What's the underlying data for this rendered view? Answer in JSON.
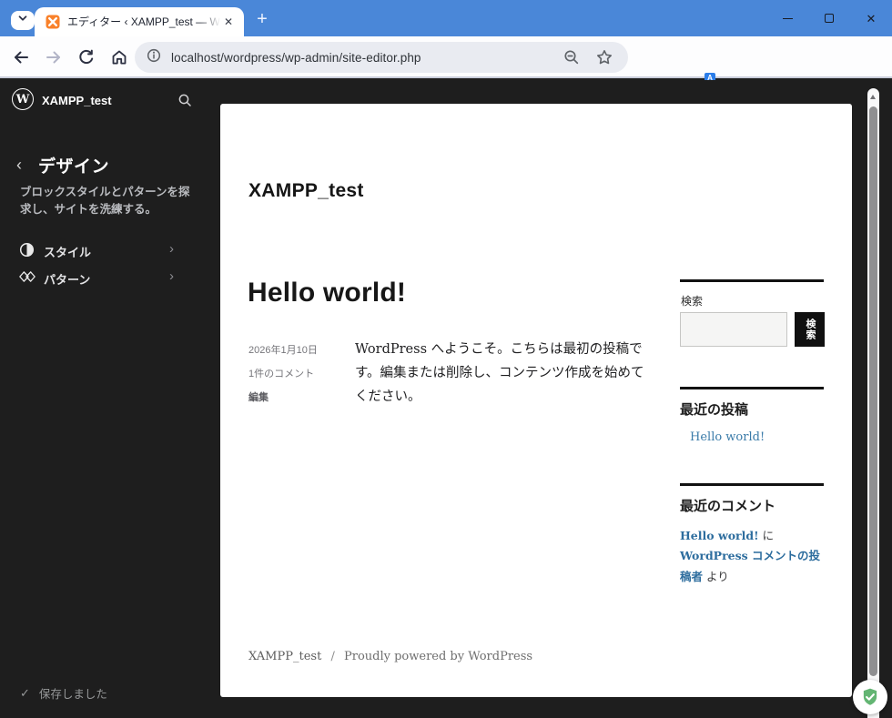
{
  "colors": {
    "tab_bar": "#4a87d8",
    "editor_bg": "#1e1e1e",
    "link_blue": "#3a7ba9",
    "comment_link_blue": "#2d6d9e",
    "search_button_bg": "#101010",
    "adguard_green": "#5cb273"
  },
  "icons": {
    "new_tab": "+",
    "close_tab": "✕",
    "kebab": "⋮",
    "back_chevron": "‹",
    "menu_chevron": "›",
    "saved_check": "✓",
    "wp_logo_letter": "W",
    "translate_back": "文",
    "translate_front": "A",
    "darkbadge_glyph": "</>"
  },
  "browser": {
    "tab_title": "エディター ‹ XAMPP_test — WordP",
    "url": "localhost/wordpress/wp-admin/site-editor.php"
  },
  "sidebar": {
    "site_name": "XAMPP_test",
    "nav_title": "デザイン",
    "description": "ブロックスタイルとパターンを探求し、サイトを洗練する。",
    "items": [
      {
        "label": "スタイル"
      },
      {
        "label": "パターン"
      }
    ],
    "save_status": "保存しました"
  },
  "page": {
    "site_title": "XAMPP_test",
    "post": {
      "title": "Hello world!",
      "date": "2026年1月10日",
      "comments": "1件のコメント",
      "edit": "編集",
      "content": "WordPress へようこそ。こちらは最初の投稿です。編集または削除し、コンテンツ作成を始めてください。"
    },
    "widgets": {
      "search": {
        "label": "検索",
        "button": "検索",
        "input_value": "",
        "input_placeholder": ""
      },
      "recent_posts": {
        "heading": "最近の投稿",
        "items": [
          "Hello world!"
        ]
      },
      "recent_comments": {
        "heading": "最近のコメント",
        "link1": "Hello world!",
        "mid": " に ",
        "link2": "WordPress コメントの投稿者",
        "tail": " より"
      }
    },
    "footer": {
      "site": "XAMPP_test",
      "separator": "/",
      "credit": "Proudly powered by WordPress"
    }
  }
}
